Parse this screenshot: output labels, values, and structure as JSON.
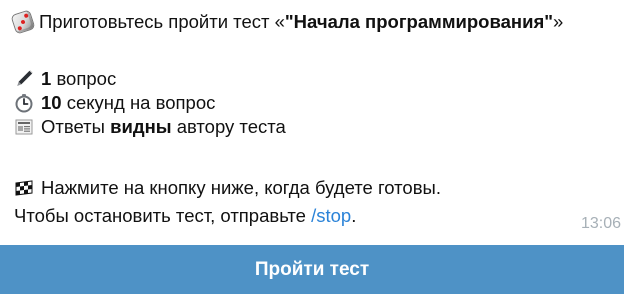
{
  "message": {
    "intro_text": "Приготовьтесь пройти тест «",
    "quiz_title": "\"Начала программирования\"",
    "intro_suffix": "»",
    "questions_count": "1",
    "questions_label": "вопрос",
    "seconds_count": "10",
    "seconds_label": "секунд на вопрос",
    "answers_prefix": "Ответы",
    "answers_bold": "видны",
    "answers_suffix": "автору теста",
    "press_text": "Нажмите на кнопку ниже, когда будете готовы.",
    "stop_prefix": "Чтобы остановить тест, отправьте",
    "stop_command": "/stop",
    "stop_suffix": ".",
    "time": "13:06",
    "icons": [
      "dice-icon",
      "pen-icon",
      "stopwatch-icon",
      "newspaper-icon",
      "checkered-flag-icon"
    ]
  },
  "button": {
    "label": "Пройти тест",
    "color": "#4e92c6"
  },
  "colors": {
    "link": "#2b83d8",
    "time": "#a7b0b7"
  }
}
